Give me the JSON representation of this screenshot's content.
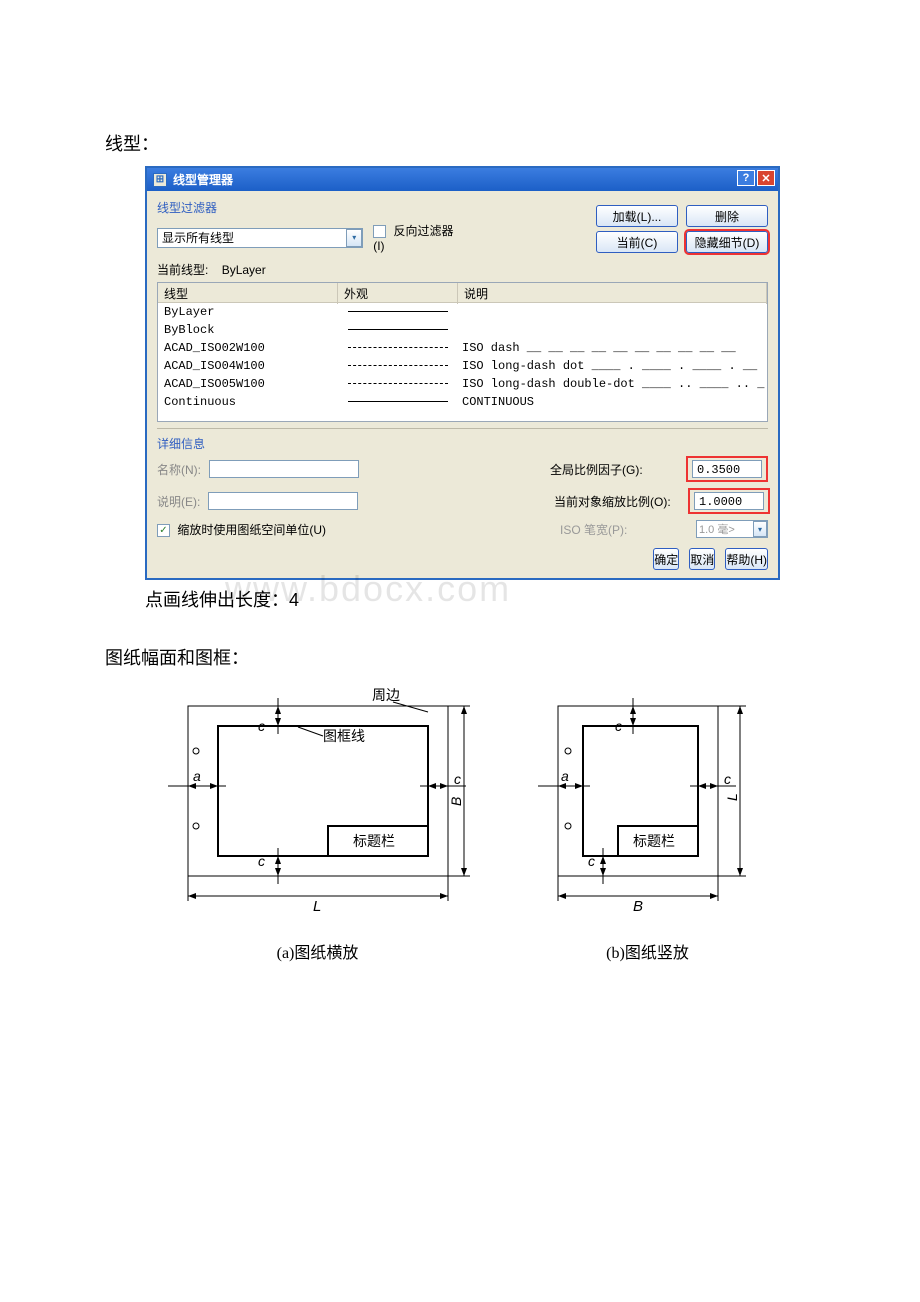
{
  "headings": {
    "linetype": "线型：",
    "frame": "图纸幅面和图框："
  },
  "dialog": {
    "title": "线型管理器",
    "filter_legend": "线型过滤器",
    "filter_value": "显示所有线型",
    "invert_filter": "反向过滤器(I)",
    "buttons": {
      "load": "加载(L)...",
      "delete": "删除",
      "current": "当前(C)",
      "hide_details": "隐藏细节(D)"
    },
    "current_label": "当前线型:",
    "current_value": "ByLayer",
    "columns": {
      "name": "线型",
      "appearance": "外观",
      "desc": "说明"
    },
    "rows": [
      {
        "name": "ByLayer",
        "desc": ""
      },
      {
        "name": "ByBlock",
        "desc": ""
      },
      {
        "name": "ACAD_ISO02W100",
        "desc": "ISO dash __ __ __ __ __ __ __ __ __ __"
      },
      {
        "name": "ACAD_ISO04W100",
        "desc": "ISO long-dash dot ____ . ____ . ____ . __"
      },
      {
        "name": "ACAD_ISO05W100",
        "desc": "ISO long-dash double-dot ____ .. ____ .. _"
      },
      {
        "name": "Continuous",
        "desc": "CONTINUOUS"
      }
    ],
    "details": {
      "legend": "详细信息",
      "name_label": "名称(N):",
      "desc_label": "说明(E):",
      "use_paper_units": "缩放时使用图纸空间单位(U)",
      "global_scale_label": "全局比例因子(G):",
      "global_scale_value": "0.3500",
      "object_scale_label": "当前对象缩放比例(O):",
      "object_scale_value": "1.0000",
      "iso_pen_label": "ISO 笔宽(P):",
      "iso_pen_value": "1.0 毫>"
    },
    "bottom": {
      "ok": "确定",
      "cancel": "取消",
      "help": "帮助(H)"
    }
  },
  "caption_under": "点画线伸出长度：4",
  "watermark": "www.bdocx.com",
  "diagrams": {
    "left_caption": "(a)图纸横放",
    "right_caption": "(b)图纸竖放",
    "labels": {
      "zhoubian": "周边",
      "tukuangxian": "图框线",
      "biaotilan": "标题栏",
      "a": "a",
      "c": "c",
      "B": "B",
      "L": "L"
    }
  }
}
